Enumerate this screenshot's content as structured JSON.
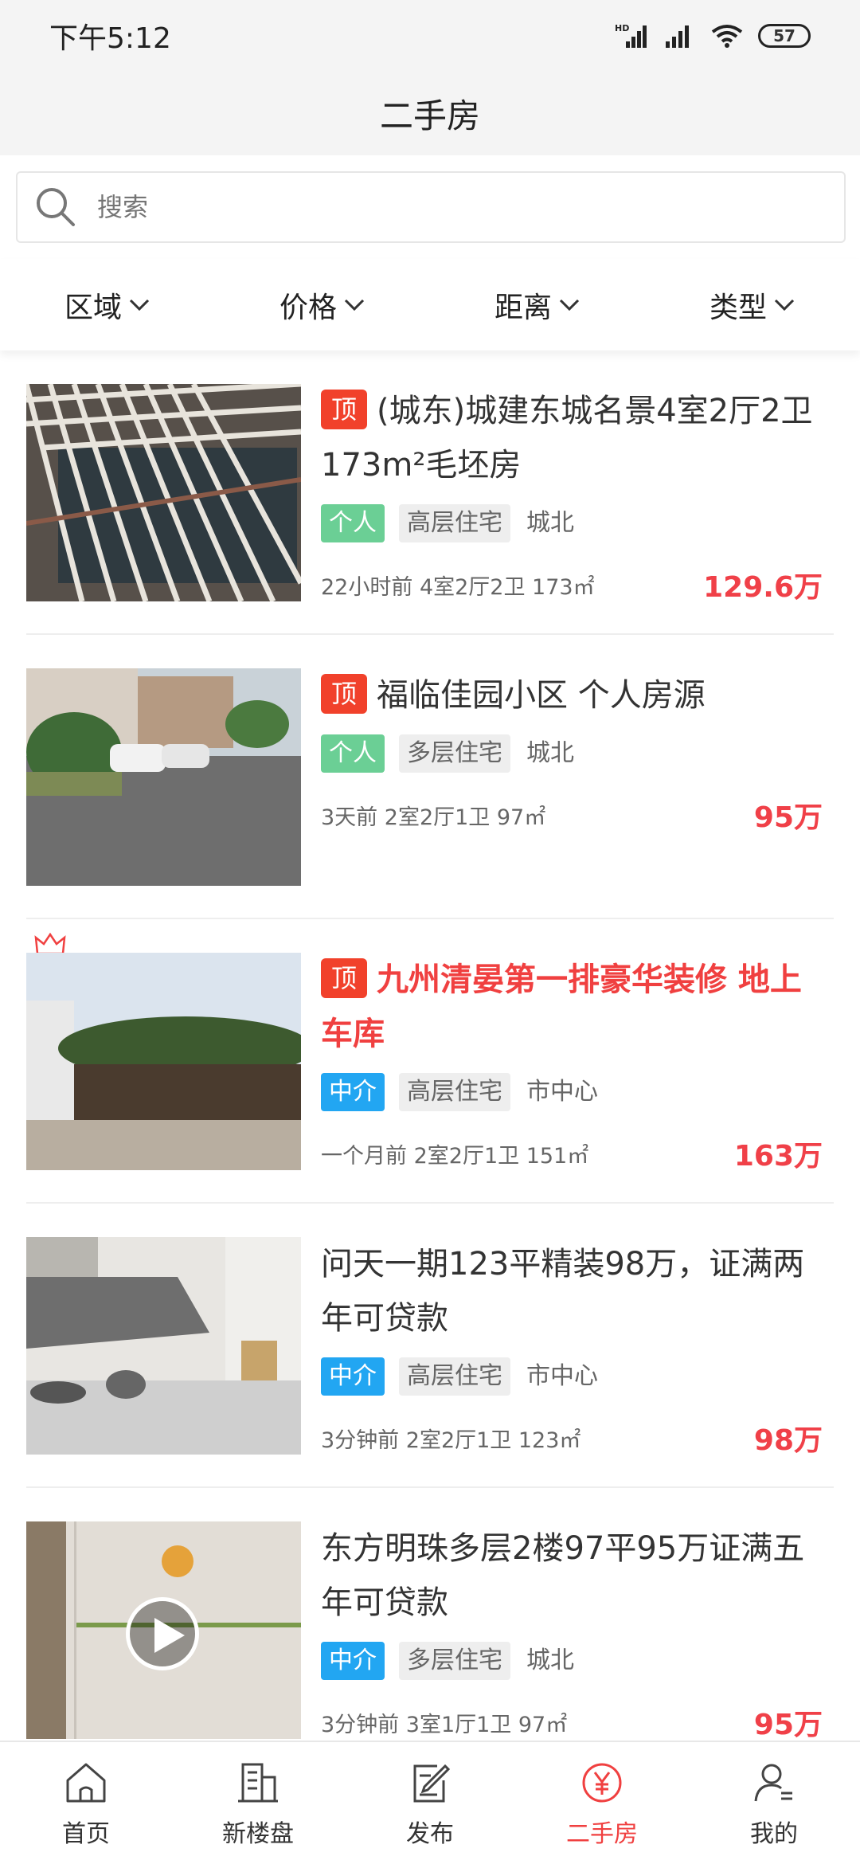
{
  "status": {
    "time": "下午5:12",
    "battery": "57",
    "network": "HD"
  },
  "nav": {
    "title": "二手房"
  },
  "search": {
    "placeholder": "搜索"
  },
  "filters": [
    {
      "label": "区域"
    },
    {
      "label": "价格"
    },
    {
      "label": "距离"
    },
    {
      "label": "类型"
    }
  ],
  "listings": [
    {
      "top": "顶",
      "title": "(城东)城建东城名景4室2厅2卫173m²毛坯房",
      "source_tag": "个人",
      "type_tag": "高层住宅",
      "area": "城北",
      "meta": "22小时前  4室2厅2卫  173㎡",
      "price": "129.6万"
    },
    {
      "top": "顶",
      "title": "福临佳园小区 个人房源",
      "source_tag": "个人",
      "type_tag": "多层住宅",
      "area": "城北",
      "meta": "3天前  2室2厅1卫  97㎡",
      "price": "95万"
    },
    {
      "top": "顶",
      "title": "九州清晏第一排豪华装修 地上车库",
      "source_tag": "中介",
      "type_tag": "高层住宅",
      "area": "市中心",
      "meta": "一个月前  2室2厅1卫  151㎡",
      "price": "163万"
    },
    {
      "title": "问天一期123平精装98万，证满两年可贷款",
      "source_tag": "中介",
      "type_tag": "高层住宅",
      "area": "市中心",
      "meta": "3分钟前  2室2厅1卫  123㎡",
      "price": "98万"
    },
    {
      "title": "东方明珠多层2楼97平95万证满五年可贷款",
      "source_tag": "中介",
      "type_tag": "多层住宅",
      "area": "城北",
      "meta": "3分钟前  3室1厅1卫  97㎡",
      "price": "95万"
    }
  ],
  "tabs": [
    {
      "label": "首页",
      "icon": "home-icon"
    },
    {
      "label": "新楼盘",
      "icon": "building-icon"
    },
    {
      "label": "发布",
      "icon": "edit-icon"
    },
    {
      "label": "二手房",
      "icon": "yuan-icon",
      "active": true
    },
    {
      "label": "我的",
      "icon": "user-icon"
    }
  ],
  "colors": {
    "accent": "#f04040",
    "top_badge": "#f1412b",
    "tag_personal": "#6bcf95",
    "tag_agency": "#22a6f2"
  }
}
